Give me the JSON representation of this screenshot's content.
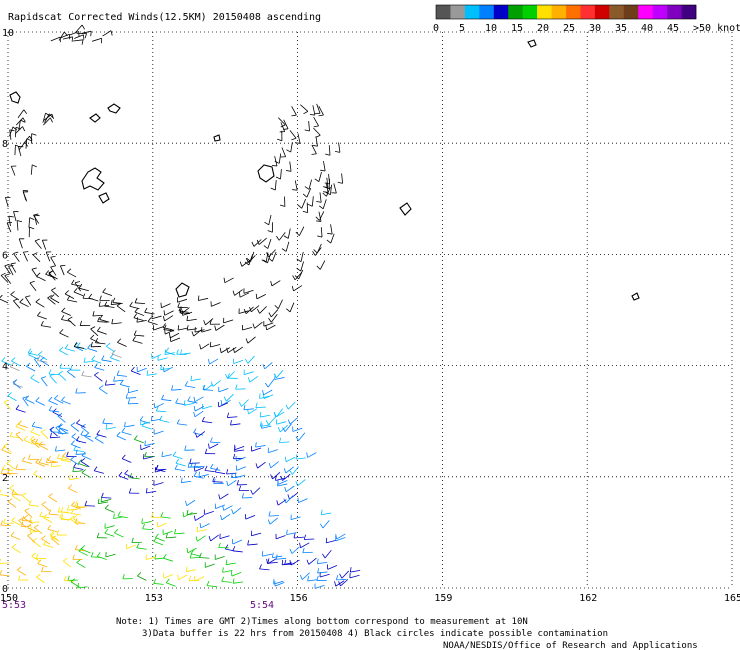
{
  "header": {
    "title": "Rapidscat Corrected Winds(12.5KM) 20150408 ascending"
  },
  "legend": {
    "ticks": [
      "0",
      "5",
      "10",
      "15",
      "20",
      "25",
      "30",
      "35",
      "40",
      "45",
      ">50 knots"
    ],
    "colors": [
      "#555555",
      "#999999",
      "#00bfff",
      "#0080ff",
      "#0000c8",
      "#00a000",
      "#00d000",
      "#ffe000",
      "#ffb000",
      "#ff7000",
      "#ff3030",
      "#d00000",
      "#8b5a2b",
      "#6e3e1a",
      "#ff00ff",
      "#c000ff",
      "#8000c0",
      "#40007f"
    ]
  },
  "axes": {
    "y_ticks": [
      "10",
      "8",
      "6",
      "4",
      "2",
      "0"
    ],
    "x_ticks": [
      "150",
      "153",
      "156",
      "159",
      "162",
      "165"
    ],
    "time_labels": [
      "5:53",
      "5:54"
    ]
  },
  "footer": {
    "note1": "Note: 1) Times are GMT 2)Times along bottom correspond to measurement at 10N",
    "note2": "3)Data buffer is 22 hrs from 20150408 4) Black circles indicate possible contamination",
    "credit": "NOAA/NESDIS/Office of Research and Applications"
  },
  "chart_data": {
    "type": "scatter",
    "title": "Rapidscat Corrected Winds(12.5KM) 20150408 ascending",
    "xlabel": "",
    "ylabel": "",
    "xlim": [
      150,
      165
    ],
    "ylim": [
      0,
      10
    ],
    "x_ticks": [
      150,
      153,
      156,
      159,
      162,
      165
    ],
    "y_ticks": [
      0,
      2,
      4,
      6,
      8,
      10
    ],
    "grid": true,
    "legend": "top-right",
    "color_scale": {
      "unit": "knots",
      "stops": [
        0,
        5,
        10,
        15,
        20,
        25,
        30,
        35,
        40,
        45,
        50
      ]
    },
    "swath_description_points": [
      {
        "lon": 150.3,
        "lat": 8.5,
        "speed": 3
      },
      {
        "lon": 151.0,
        "lat": 6.0,
        "speed": 4
      },
      {
        "lon": 151.5,
        "lat": 4.5,
        "speed": 7
      },
      {
        "lon": 152.0,
        "lat": 3.0,
        "speed": 10
      },
      {
        "lon": 152.5,
        "lat": 2.0,
        "speed": 14
      },
      {
        "lon": 153.5,
        "lat": 3.0,
        "speed": 9
      },
      {
        "lon": 154.5,
        "lat": 2.5,
        "speed": 11
      },
      {
        "lon": 155.5,
        "lat": 3.5,
        "speed": 8
      },
      {
        "lon": 156.2,
        "lat": 5.0,
        "speed": 4
      },
      {
        "lon": 157.0,
        "lat": 6.5,
        "speed": 3
      },
      {
        "lon": 157.8,
        "lat": 7.5,
        "speed": 3
      },
      {
        "lon": 150.8,
        "lat": 1.5,
        "speed": 22
      },
      {
        "lon": 152.8,
        "lat": 0.8,
        "speed": 18
      }
    ]
  }
}
